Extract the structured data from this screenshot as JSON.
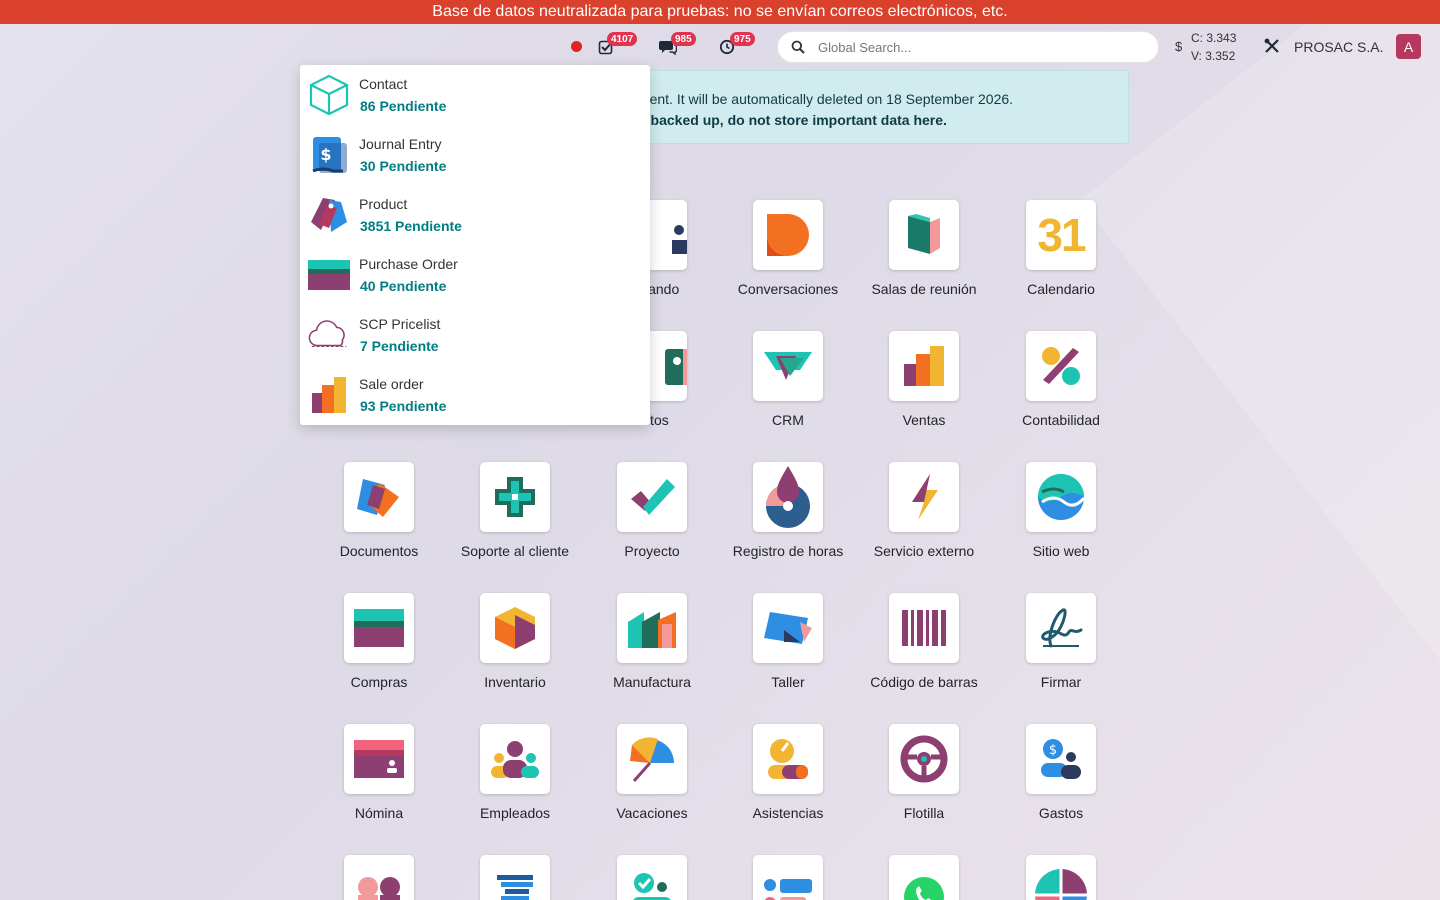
{
  "banner": {
    "text": "Base de datos neutralizada para pruebas: no se envían correos electrónicos, etc."
  },
  "navbar": {
    "badges": {
      "activities": "4107",
      "messages": "985",
      "timesheets": "975"
    },
    "search_placeholder": "Global Search...",
    "currency_sign": "$",
    "rate_c": "C: 3.343",
    "rate_v": "V: 3.352",
    "company": "PROSAC S.A.",
    "avatar_letter": "A"
  },
  "info": {
    "line1": "environment. It will be automatically deleted on 18 September 2026.",
    "line2": "t backed up, do not store important data here."
  },
  "activities": [
    {
      "name": "Contact",
      "count": "86 Pendiente",
      "icon": "box-icon"
    },
    {
      "name": "Journal Entry",
      "count": "30 Pendiente",
      "icon": "invoice-icon"
    },
    {
      "name": "Product",
      "count": "3851 Pendiente",
      "icon": "tag-icon"
    },
    {
      "name": "Purchase Order",
      "count": "40 Pendiente",
      "icon": "card-icon"
    },
    {
      "name": "SCP Pricelist",
      "count": "7 Pendiente",
      "icon": "cloud-icon"
    },
    {
      "name": "Sale order",
      "count": "93 Pendiente",
      "icon": "chart-icon"
    }
  ],
  "apps": {
    "tablero": "e Mando",
    "conversaciones": "Conversaciones",
    "salas": "Salas de reunión",
    "calendario": "Calendario",
    "calendario_day": "31",
    "contactos": "actos",
    "crm": "CRM",
    "ventas": "Ventas",
    "contabilidad": "Contabilidad",
    "documentos": "Documentos",
    "soporte": "Soporte al cliente",
    "proyecto": "Proyecto",
    "horas": "Registro de horas",
    "servicio": "Servicio externo",
    "sitio": "Sitio web",
    "compras": "Compras",
    "inventario": "Inventario",
    "manufactura": "Manufactura",
    "taller": "Taller",
    "barras": "Código de barras",
    "firmar": "Firmar",
    "nomina": "Nómina",
    "empleados": "Empleados",
    "vacaciones": "Vacaciones",
    "asistencias": "Asistencias",
    "flotilla": "Flotilla",
    "gastos": "Gastos"
  },
  "colors": {
    "banner": "#d9412c",
    "badge": "#e0334f",
    "teal": "#017e84",
    "avatar": "#b5385e"
  }
}
